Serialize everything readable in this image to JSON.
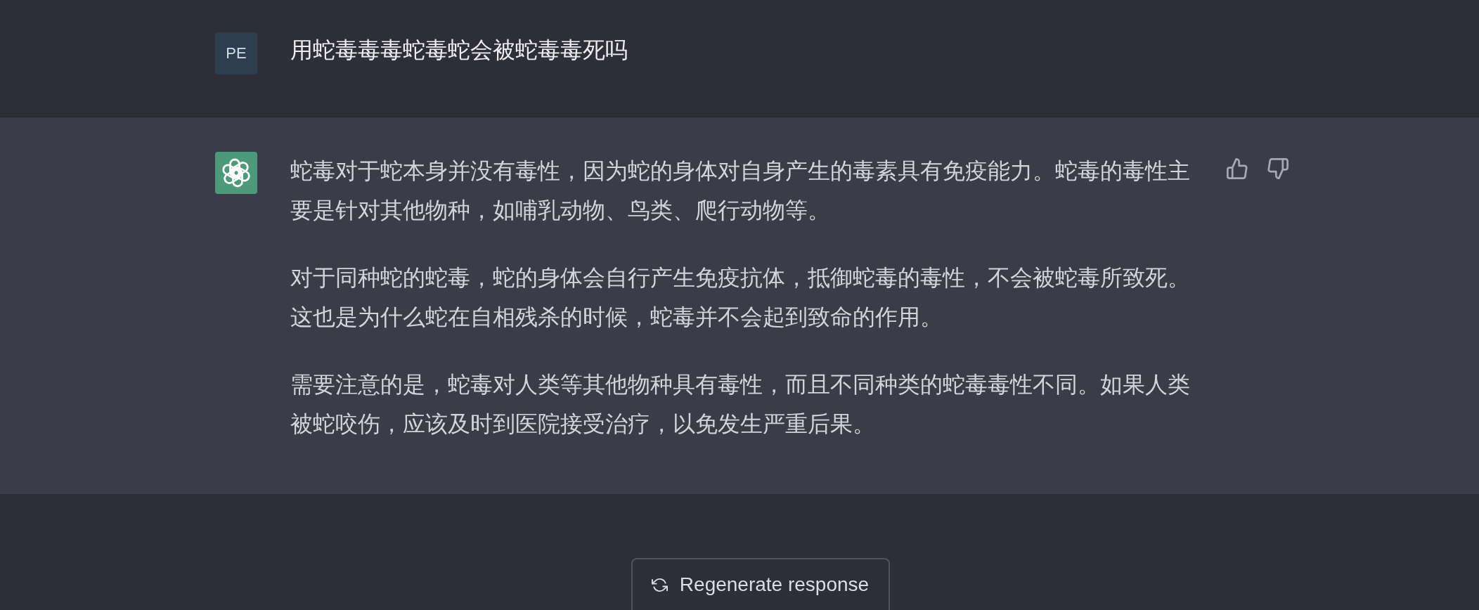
{
  "conversation": [
    {
      "kind": "user",
      "avatar": "PE",
      "text": "用蛇毒毒毒蛇毒蛇会被蛇毒毒死吗"
    },
    {
      "kind": "assistant",
      "paragraphs": [
        "蛇毒对于蛇本身并没有毒性，因为蛇的身体对自身产生的毒素具有免疫能力。蛇毒的毒性主要是针对其他物种，如哺乳动物、鸟类、爬行动物等。",
        "对于同种蛇的蛇毒，蛇的身体会自行产生免疫抗体，抵御蛇毒的毒性，不会被蛇毒所致死。这也是为什么蛇在自相残杀的时候，蛇毒并不会起到致命的作用。",
        "需要注意的是，蛇毒对人类等其他物种具有毒性，而且不同种类的蛇毒毒性不同。如果人类被蛇咬伤，应该及时到医院接受治疗，以免发生严重后果。"
      ]
    }
  ],
  "regenerate_button": {
    "label": "Regenerate response"
  }
}
